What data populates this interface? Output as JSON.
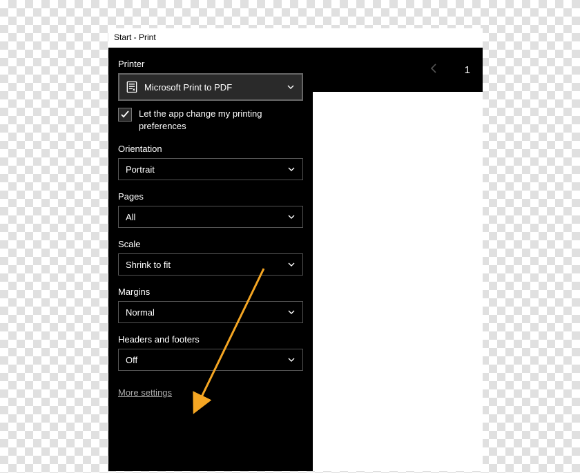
{
  "window": {
    "title": "Start - Print"
  },
  "panel": {
    "printer": {
      "label": "Printer",
      "value": "Microsoft Print to PDF"
    },
    "checkbox": {
      "checked": true,
      "label": "Let the app change my printing preferences"
    },
    "orientation": {
      "label": "Orientation",
      "value": "Portrait"
    },
    "pages": {
      "label": "Pages",
      "value": "All"
    },
    "scale": {
      "label": "Scale",
      "value": "Shrink to fit"
    },
    "margins": {
      "label": "Margins",
      "value": "Normal"
    },
    "headers_footers": {
      "label": "Headers and footers",
      "value": "Off"
    },
    "more_settings": "More settings"
  },
  "preview": {
    "current_page": "1"
  },
  "annotation": {
    "arrow_color": "#f5a623"
  }
}
